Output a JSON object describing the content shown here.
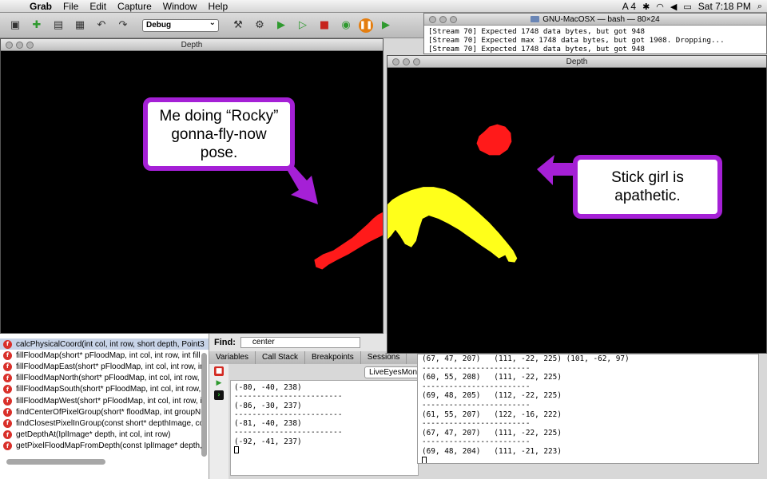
{
  "menubar": {
    "app_name": "Grab",
    "menus": [
      "File",
      "Edit",
      "Capture",
      "Window",
      "Help"
    ],
    "status_text": "A 4",
    "clock": "Sat 7:18 PM"
  },
  "toolbar": {
    "configuration": "Debug"
  },
  "terminal": {
    "title": "GNU-MacOSX — bash — 80×24",
    "lines": [
      "[Stream 70] Expected 1748 data bytes, but got 948",
      "[Stream 70] Expected max 1748 data bytes, but got 1908. Dropping...",
      "[Stream 70] Expected 1748 data bytes, but got 948"
    ]
  },
  "depth_left": {
    "title": "Depth"
  },
  "depth_right": {
    "title": "Depth"
  },
  "callouts": {
    "rocky_line1": "Me doing “Rocky”",
    "rocky_line2": "gonna-fly-now",
    "rocky_line3": "pose.",
    "stick_line1": "Stick girl is",
    "stick_line2": "apathetic."
  },
  "symbols": [
    "calcPhysicalCoord(int col, int row, short depth, Point3",
    "fillFloodMap(short* pFloodMap, int col, int row, int fill",
    "fillFloodMapEast(short* pFloodMap, int col, int row, in",
    "fillFloodMapNorth(short* pFloodMap, int col, int row,",
    "fillFloodMapSouth(short* pFloodMap, int col, int row,",
    "fillFloodMapWest(short* pFloodMap, int col, int row, i",
    "findCenterOfPixelGroup(short* floodMap, int groupNu",
    "findClosestPixelInGroup(const short* depthImage, co",
    "getDepthAt(IplImage* depth, int col, int row)",
    "getPixelFloodMapFromDepth(const IplImage* depth,"
  ],
  "find": {
    "label": "Find:",
    "value": "center"
  },
  "debug_tabs": [
    "Variables",
    "Call Stack",
    "Breakpoints",
    "Sessions"
  ],
  "console_target": "LiveEyesMonitor",
  "console_left": [
    "(-80, -40, 238)",
    "------------------------",
    "(-86, -30, 237)",
    "------------------------",
    "(-81, -40, 238)",
    "------------------------",
    "(-92, -41, 237)"
  ],
  "console_right": [
    "(67, 47, 207)   (111, -22, 225) (101, -62, 97)",
    "------------------------",
    "(60, 55, 208)   (111, -22, 225)",
    "------------------------",
    "(69, 48, 205)   (112, -22, 225)",
    "------------------------",
    "(61, 55, 207)   (122, -16, 222)",
    "------------------------",
    "(67, 47, 207)   (111, -22, 225)",
    "------------------------",
    "(69, 48, 204)   (111, -21, 223)"
  ],
  "colors": {
    "callout_border": "#a520d6",
    "blob_red": "#ff1a1a",
    "blob_yellow": "#ffff1a"
  }
}
